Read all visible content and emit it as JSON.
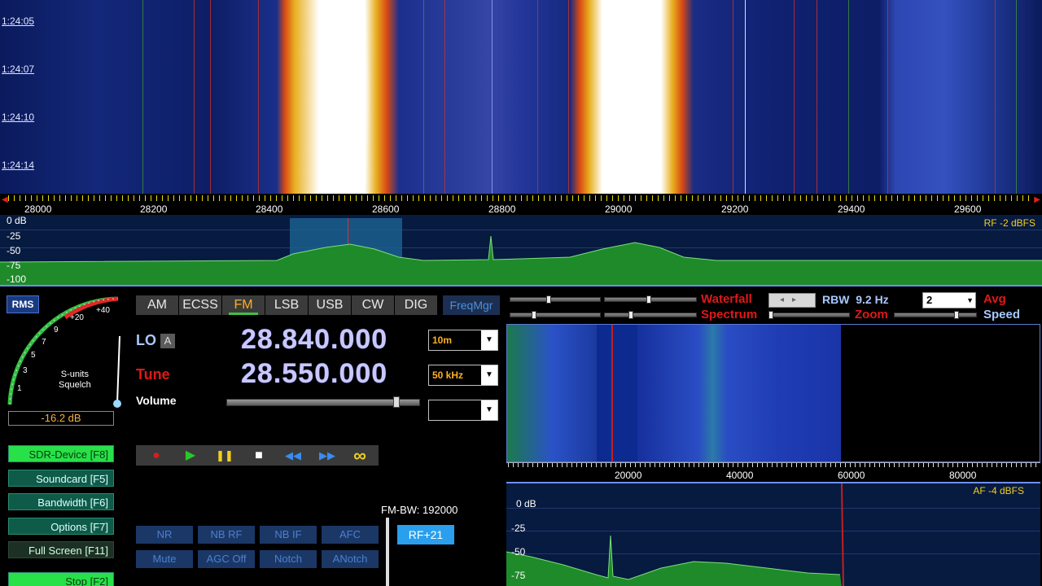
{
  "waterfall": {
    "timestamps": [
      "1:24:05",
      "1:24:07",
      "1:24:10",
      "1:24:14"
    ]
  },
  "freq_scale": {
    "labels": [
      "28000",
      "28200",
      "28400",
      "28600",
      "28800",
      "29000",
      "29200",
      "29400",
      "29600"
    ]
  },
  "spectrum": {
    "db_labels": [
      "0 dB",
      "-25",
      "-50",
      "-75",
      "-100"
    ],
    "rf_level": "RF  -2 dBFS"
  },
  "meter": {
    "rms_label": "RMS",
    "scale": [
      "1",
      "3",
      "5",
      "7",
      "9",
      "+20",
      "+40"
    ],
    "center_line1": "S-units",
    "center_line2": "Squelch",
    "readout": "-16.2 dB"
  },
  "left_buttons": [
    {
      "label": "SDR-Device [F8]"
    },
    {
      "label": "Soundcard  [F5]"
    },
    {
      "label": "Bandwidth  [F6]"
    },
    {
      "label": "Options    [F7]"
    },
    {
      "label": "Full Screen [F11]"
    },
    {
      "label": "Stop    [F2]"
    }
  ],
  "modes": [
    "AM",
    "ECSS",
    "FM",
    "LSB",
    "USB",
    "CW",
    "DIG"
  ],
  "active_mode": "FM",
  "freqmgr_label": "FreqMgr",
  "lo": {
    "label": "LO",
    "badge": "A",
    "value": "28.840.000",
    "band": "10m"
  },
  "tune": {
    "label": "Tune",
    "value": "28.550.000",
    "step": "50 kHz"
  },
  "volume_label": "Volume",
  "volume_level": 0.88,
  "dropdown_arrow": "▼",
  "transport": [
    "●",
    "▶",
    "❚❚",
    "■",
    "◀◀",
    "▶▶",
    "∞"
  ],
  "dsp_buttons_row1": [
    "NR",
    "NB RF",
    "NB IF",
    "AFC"
  ],
  "dsp_buttons_row2": [
    "Mute",
    "AGC Off",
    "Notch",
    "ANotch"
  ],
  "rf_gain_button": "RF+21",
  "fm_bw": "FM-BW: 192000",
  "right_controls": {
    "waterfall_label": "Waterfall",
    "spectrum_label": "Spectrum",
    "zoom_label": "Zoom",
    "rbw_label": "RBW",
    "rbw_value": "9.2 Hz",
    "avg_select": "2",
    "avg_label": "Avg",
    "speed_label": "Speed"
  },
  "audio_scale": {
    "labels": [
      "20000",
      "40000",
      "60000",
      "80000"
    ]
  },
  "audio_spectrum": {
    "db_labels": [
      "0 dB",
      "-25",
      "-50",
      "-75"
    ],
    "af_level": "AF  -4 dBFS"
  }
}
